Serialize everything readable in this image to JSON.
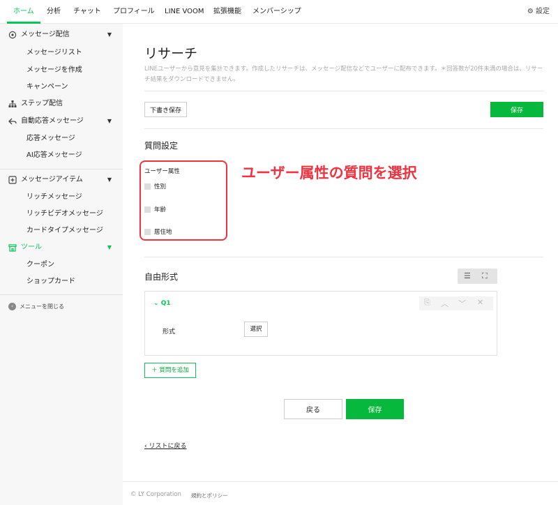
{
  "topnav": {
    "tabs": [
      {
        "label": "ホーム"
      },
      {
        "label": "分析"
      },
      {
        "label": "チャット"
      },
      {
        "label": "プロフィール"
      },
      {
        "label": "LINE VOOM"
      },
      {
        "label": "拡張機能"
      },
      {
        "label": "メンバーシップ"
      }
    ],
    "active_tab": "ホーム",
    "settings_label": "設定"
  },
  "sidebar": {
    "message_delivery": "メッセージ配信",
    "message_list": "メッセージリスト",
    "create_message": "メッセージを作成",
    "campaign": "キャンペーン",
    "step_delivery": "ステップ配信",
    "auto_reply": "自動応答メッセージ",
    "reply_message": "応答メッセージ",
    "ai_reply": "AI応答メッセージ",
    "message_items": "メッセージアイテム",
    "rich_message": "リッチメッセージ",
    "rich_video": "リッチビデオメッセージ",
    "card_type": "カードタイプメッセージ",
    "tools": "ツール",
    "coupon": "クーポン",
    "shop_card": "ショップカード",
    "close_menu": "メニューを閉じる"
  },
  "main": {
    "title": "リサーチ",
    "description": "LINEユーザーから意見を集計できます。作成したリサーチは、メッセージ配信などでユーザーに配布できます。＊回答数が20件未満の場合は、リサーチ結果をダウンロードできません。",
    "save_draft": "下書き保存",
    "save": "保存",
    "question_settings": "質問設定",
    "user_attributes": "ユーザー属性",
    "attributes": [
      {
        "label": "性別"
      },
      {
        "label": "年齢"
      },
      {
        "label": "居住地"
      }
    ],
    "annotation": "ユーザー属性の質問を選択",
    "free_format": "自由形式",
    "q1_label": "Q1",
    "format_label": "形式",
    "select_label": "選択",
    "add_question": "＋ 質問を追加",
    "back": "戻る",
    "save_bottom": "保存",
    "back_to_list": "リストに戻る"
  },
  "footer": {
    "copyright": "© LY Corporation",
    "policy": "規約とポリシー"
  },
  "colors": {
    "accent": "#06c755",
    "annotation": "#ef3340"
  }
}
